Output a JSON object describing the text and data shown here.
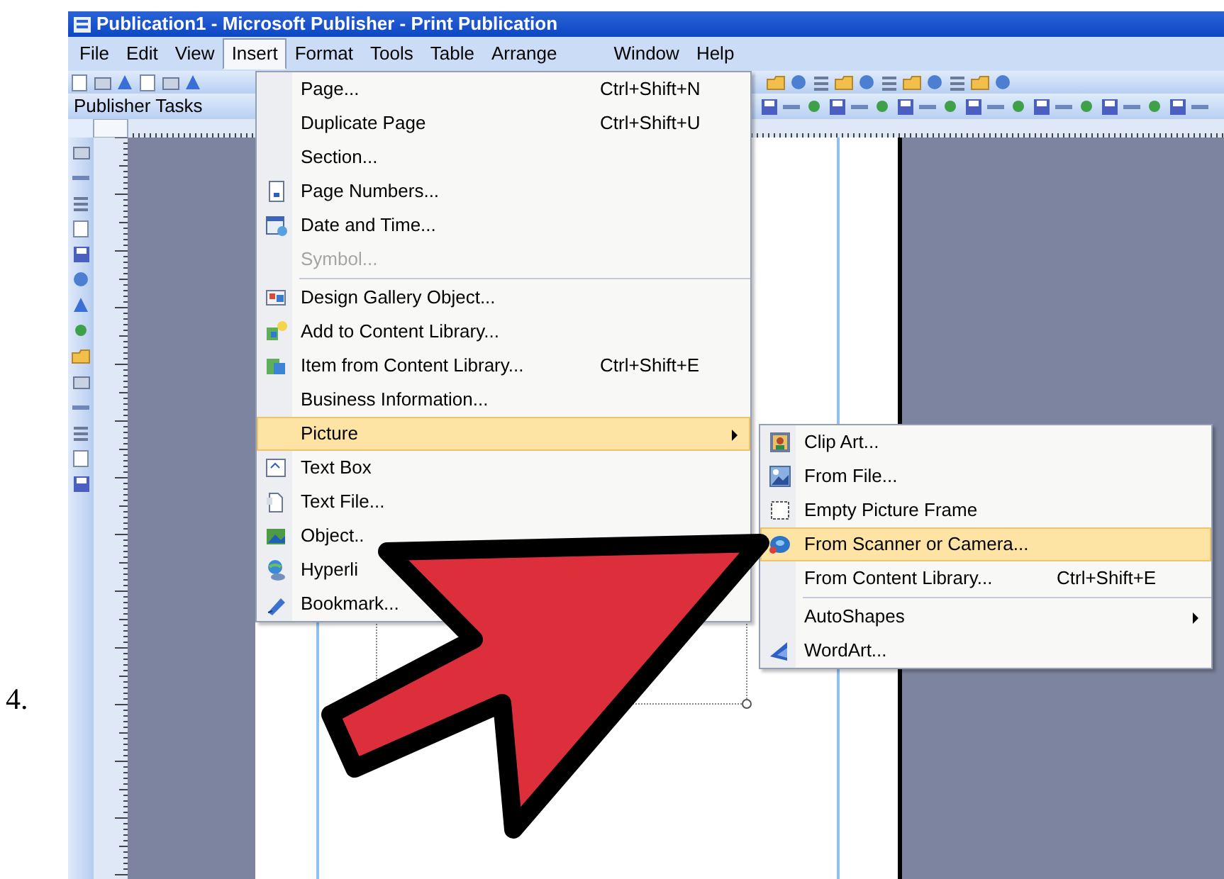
{
  "step_number": "4.",
  "window": {
    "title": "Publication1 - Microsoft Publisher - Print Publication"
  },
  "menu_bar": [
    {
      "label": "File",
      "selected": false
    },
    {
      "label": "Edit",
      "selected": false
    },
    {
      "label": "View",
      "selected": false
    },
    {
      "label": "Insert",
      "selected": true
    },
    {
      "label": "Format",
      "selected": false
    },
    {
      "label": "Tools",
      "selected": false
    },
    {
      "label": "Table",
      "selected": false
    },
    {
      "label": "Arrange",
      "selected": false
    },
    {
      "label": "Window",
      "selected": false
    },
    {
      "label": "Help",
      "selected": false
    }
  ],
  "task_toolbar": {
    "label": "Publisher Tasks"
  },
  "insert_menu": {
    "groups": [
      [
        {
          "label": "Page...",
          "shortcut": "Ctrl+Shift+N",
          "disabled": false,
          "selected": false,
          "submenu": false
        },
        {
          "label": "Duplicate Page",
          "shortcut": "Ctrl+Shift+U",
          "disabled": false,
          "selected": false,
          "submenu": false
        },
        {
          "label": "Section...",
          "disabled": false,
          "selected": false,
          "submenu": false
        },
        {
          "label": "Page Numbers...",
          "disabled": false,
          "selected": false,
          "submenu": false
        },
        {
          "label": "Date and Time...",
          "disabled": false,
          "selected": false,
          "submenu": false
        },
        {
          "label": "Symbol...",
          "disabled": true,
          "selected": false,
          "submenu": false
        }
      ],
      [
        {
          "label": "Design Gallery Object...",
          "disabled": false,
          "selected": false,
          "submenu": false
        },
        {
          "label": "Add to Content Library...",
          "disabled": false,
          "selected": false,
          "submenu": false
        },
        {
          "label": "Item from Content Library...",
          "shortcut": "Ctrl+Shift+E",
          "disabled": false,
          "selected": false,
          "submenu": false
        },
        {
          "label": "Business Information...",
          "disabled": false,
          "selected": false,
          "submenu": false
        },
        {
          "label": "Picture",
          "disabled": false,
          "selected": true,
          "submenu": true
        },
        {
          "label": "Text Box",
          "disabled": false,
          "selected": false,
          "submenu": false
        },
        {
          "label": "Text File...",
          "disabled": false,
          "selected": false,
          "submenu": false
        },
        {
          "label": "Object..",
          "disabled": false,
          "selected": false,
          "submenu": false
        },
        {
          "label": "Hyperli",
          "disabled": false,
          "selected": false,
          "submenu": false
        },
        {
          "label": "Bookmark...",
          "disabled": false,
          "selected": false,
          "submenu": false
        }
      ]
    ]
  },
  "picture_submenu": {
    "groups": [
      [
        {
          "label": "Clip Art...",
          "disabled": false,
          "selected": false,
          "submenu": false
        },
        {
          "label": "From File...",
          "disabled": false,
          "selected": false,
          "submenu": false
        },
        {
          "label": "Empty Picture Frame",
          "disabled": false,
          "selected": false,
          "submenu": false
        },
        {
          "label": "From Scanner or Camera...",
          "disabled": false,
          "selected": true,
          "submenu": false
        },
        {
          "label": "From Content Library...",
          "shortcut": "Ctrl+Shift+E",
          "disabled": false,
          "selected": false,
          "submenu": false
        }
      ],
      [
        {
          "label": "AutoShapes",
          "disabled": false,
          "selected": false,
          "submenu": true
        },
        {
          "label": "WordArt...",
          "disabled": false,
          "selected": false,
          "submenu": false
        }
      ]
    ]
  }
}
